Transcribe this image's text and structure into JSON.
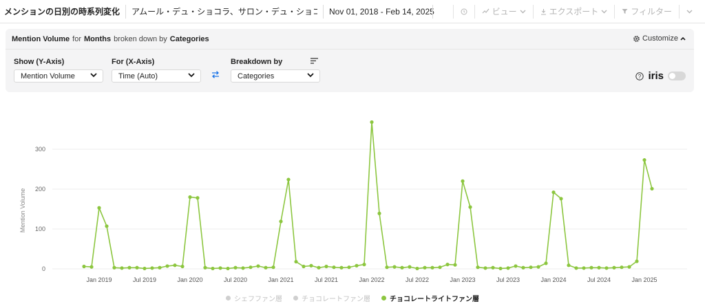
{
  "header": {
    "title": "メンションの日別の時系列変化",
    "brands": "アムール・デュ・ショコラ、サロン・デュ・ショコラ、...",
    "date_range": "Nov 01, 2018 - Feb 14, 2025",
    "view_label": "ビュー",
    "export_label": "エクスポート",
    "filter_label": "フィルター"
  },
  "panel": {
    "summary": {
      "metric": "Mention Volume",
      "for_word": "for",
      "period": "Months",
      "breakdown_word": "broken down by",
      "dimension": "Categories"
    },
    "customize_label": "Customize",
    "show_label": "Show (Y-Axis)",
    "show_value": "Mention Volume",
    "for_label": "For (X-Axis)",
    "for_value": "Time (Auto)",
    "breakdown_label": "Breakdown by",
    "breakdown_value": "Categories",
    "iris_label": "iris"
  },
  "colors": {
    "series_active": "#8cc63f",
    "legend_inactive": "#cfcfcf",
    "accent_blue": "#1a73e8"
  },
  "chart_data": {
    "type": "line",
    "ylabel": "Mention Volume",
    "ylim": [
      0,
      330
    ],
    "yticks": [
      0,
      100,
      200,
      300
    ],
    "x_tick_labels": [
      "Jan 2019",
      "Jul 2019",
      "Jan 2020",
      "Jul 2020",
      "Jan 2021",
      "Jul 2021",
      "Jan 2022",
      "Jul 2022",
      "Jan 2023",
      "Jul 2023",
      "Jan 2024",
      "Jul 2024",
      "Jan 2025"
    ],
    "x_start": "Nov 2018",
    "grid": true,
    "legend_position": "bottom",
    "series": [
      {
        "name": "シェフファン層",
        "active": false,
        "values": []
      },
      {
        "name": "チョコレートファン層",
        "active": false,
        "values": []
      },
      {
        "name": "チョコレートライトファン層",
        "active": true,
        "values": [
          6,
          5,
          153,
          107,
          3,
          2,
          3,
          3,
          1,
          2,
          3,
          7,
          9,
          6,
          180,
          178,
          3,
          1,
          2,
          1,
          3,
          2,
          4,
          7,
          3,
          4,
          119,
          224,
          18,
          6,
          8,
          3,
          6,
          4,
          3,
          4,
          8,
          11,
          368,
          139,
          4,
          5,
          3,
          5,
          1,
          3,
          3,
          4,
          11,
          10,
          220,
          155,
          4,
          2,
          3,
          1,
          2,
          7,
          3,
          4,
          5,
          14,
          192,
          176,
          9,
          2,
          2,
          3,
          3,
          2,
          3,
          4,
          5,
          19,
          273,
          201
        ]
      }
    ]
  }
}
